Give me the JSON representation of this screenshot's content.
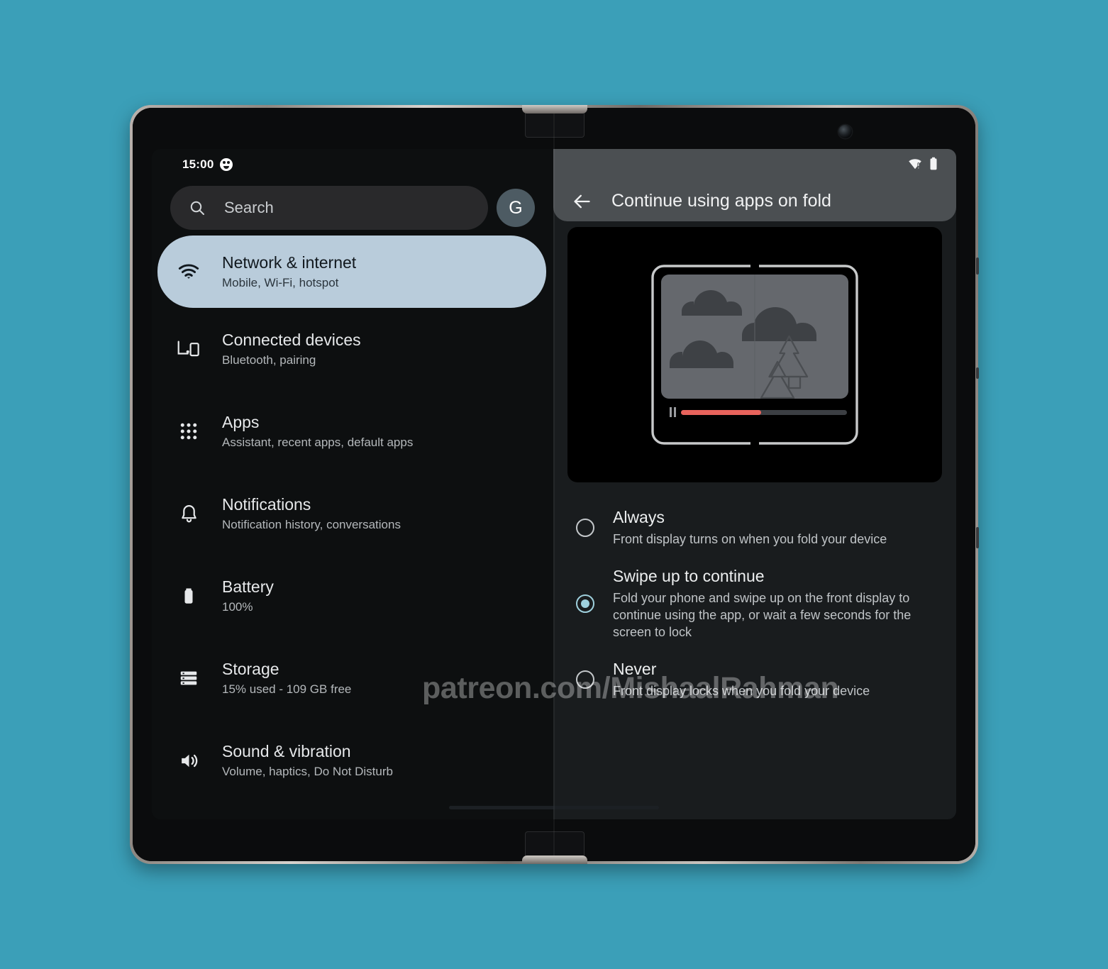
{
  "background_color": "#3b9fb8",
  "device": {
    "type": "foldable-phone",
    "frame_color": "#b9b2ad",
    "camera": "front-camera-punch-hole"
  },
  "left_pane": {
    "status_bar": {
      "time": "15:00",
      "icon": "cat-face-icon"
    },
    "search": {
      "placeholder": "Search",
      "icon": "search-icon"
    },
    "avatar": {
      "label": "G"
    },
    "settings_list": [
      {
        "icon": "wifi-icon",
        "title": "Network & internet",
        "subtitle": "Mobile, Wi-Fi, hotspot",
        "selected": true
      },
      {
        "icon": "connected-devices-icon",
        "title": "Connected devices",
        "subtitle": "Bluetooth, pairing",
        "selected": false
      },
      {
        "icon": "apps-grid-icon",
        "title": "Apps",
        "subtitle": "Assistant, recent apps, default apps",
        "selected": false
      },
      {
        "icon": "bell-icon",
        "title": "Notifications",
        "subtitle": "Notification history, conversations",
        "selected": false
      },
      {
        "icon": "battery-icon",
        "title": "Battery",
        "subtitle": "100%",
        "selected": false
      },
      {
        "icon": "storage-icon",
        "title": "Storage",
        "subtitle": "15% used - 109 GB free",
        "selected": false
      },
      {
        "icon": "volume-icon",
        "title": "Sound & vibration",
        "subtitle": "Volume, haptics, Do Not Disturb",
        "selected": false
      }
    ],
    "selected_accent": "#b9ccdb"
  },
  "right_pane": {
    "status_icons": [
      "wifi-no-internet-icon",
      "battery-icon"
    ],
    "back_icon": "back-arrow-icon",
    "title": "Continue using apps on fold",
    "illustration": {
      "description": "folded-device-video-playback-illustration",
      "progress_color": "#e8635c",
      "progress_percent": 48
    },
    "options": [
      {
        "title": "Always",
        "subtitle": "Front display turns on when you fold your device",
        "selected": false
      },
      {
        "title": "Swipe up to continue",
        "subtitle": "Fold your phone and swipe up on the front display to continue using the app, or wait a few seconds for the screen to lock",
        "selected": true
      },
      {
        "title": "Never",
        "subtitle": "Front display locks when you fold your device",
        "selected": false
      }
    ],
    "radio_accent": "#9fd0dd"
  },
  "watermark": {
    "text": "patreon.com/MishaalRahman"
  }
}
